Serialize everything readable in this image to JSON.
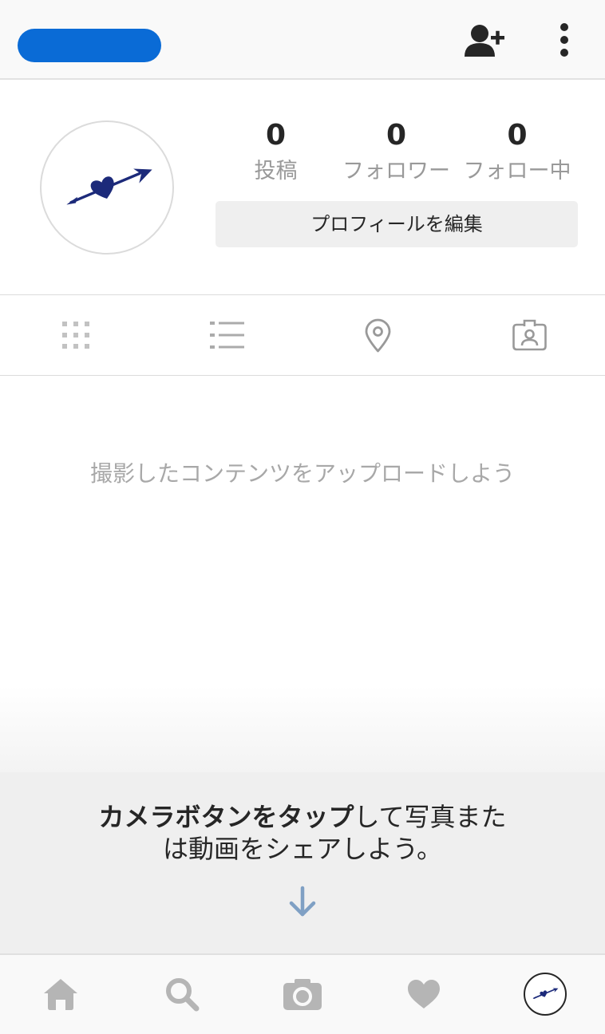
{
  "header": {
    "username_redaction": "redacted-username",
    "add_user_icon": "add-user-icon",
    "menu_icon": "more-vertical-icon"
  },
  "profile": {
    "avatar_icon": "heart-arrow-drawing",
    "stats": [
      {
        "value": "0",
        "label": "投稿"
      },
      {
        "value": "0",
        "label": "フォロワー"
      },
      {
        "value": "0",
        "label": "フォロー中"
      }
    ],
    "edit_button_label": "プロフィールを編集"
  },
  "tabs": [
    {
      "icon": "grid-icon"
    },
    {
      "icon": "list-icon"
    },
    {
      "icon": "location-pin-icon"
    },
    {
      "icon": "tagged-photos-icon"
    }
  ],
  "empty_state": {
    "message": "撮影したコンテンツをアップロードしよう"
  },
  "tip": {
    "line1_bold": "カメラボタンをタップ",
    "line1_rest": "して写真また",
    "line2": "は動画をシェアしよう。",
    "arrow_icon": "arrow-down-icon"
  },
  "bottom_nav": [
    {
      "icon": "home-icon"
    },
    {
      "icon": "search-icon"
    },
    {
      "icon": "camera-icon"
    },
    {
      "icon": "heart-icon"
    },
    {
      "icon": "profile-avatar-icon",
      "selected": true
    }
  ],
  "colors": {
    "text": "#262626",
    "muted": "#999999",
    "redaction": "#0a6bd6",
    "avatar_drawing": "#1c2a7a",
    "tip_arrow": "#7fa0c4",
    "nav_icon": "#b5b5b5",
    "tip_background": "#efefef"
  }
}
